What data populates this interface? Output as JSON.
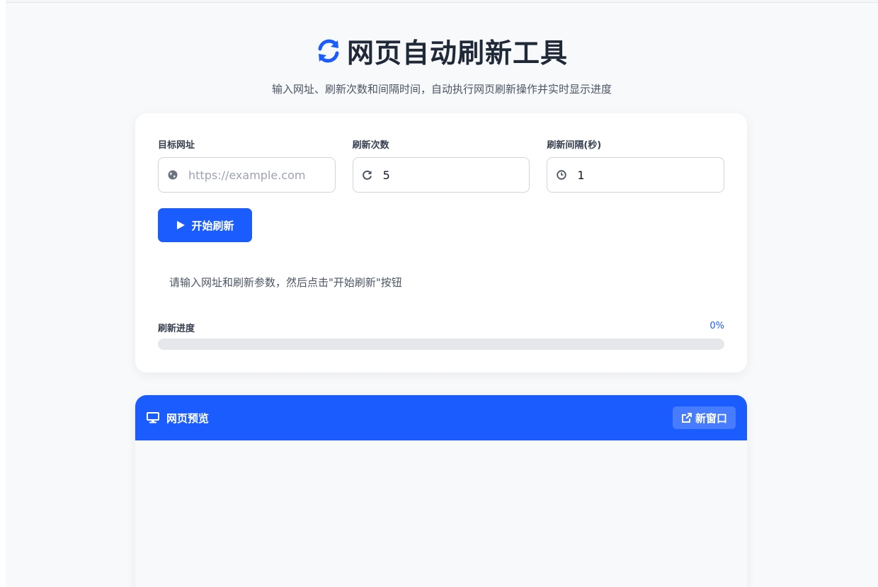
{
  "header": {
    "icon": "refresh-icon",
    "title": "网页自动刷新工具",
    "subtitle": "输入网址、刷新次数和间隔时间，自动执行网页刷新操作并实时显示进度"
  },
  "form": {
    "url": {
      "label": "目标网址",
      "placeholder": "https://example.com",
      "value": "",
      "icon": "globe-icon"
    },
    "count": {
      "label": "刷新次数",
      "value": "5",
      "icon": "redo-icon"
    },
    "interval": {
      "label": "刷新间隔(秒)",
      "value": "1",
      "icon": "clock-icon"
    },
    "start_button": "开始刷新",
    "status": "请输入网址和刷新参数，然后点击\"开始刷新\"按钮"
  },
  "progress": {
    "label": "刷新进度",
    "percent_text": "0%",
    "fraction": 0
  },
  "preview": {
    "title": "网页预览",
    "new_window_button": "新窗口",
    "icon": "monitor-icon"
  },
  "colors": {
    "accent": "#1a5cff"
  }
}
